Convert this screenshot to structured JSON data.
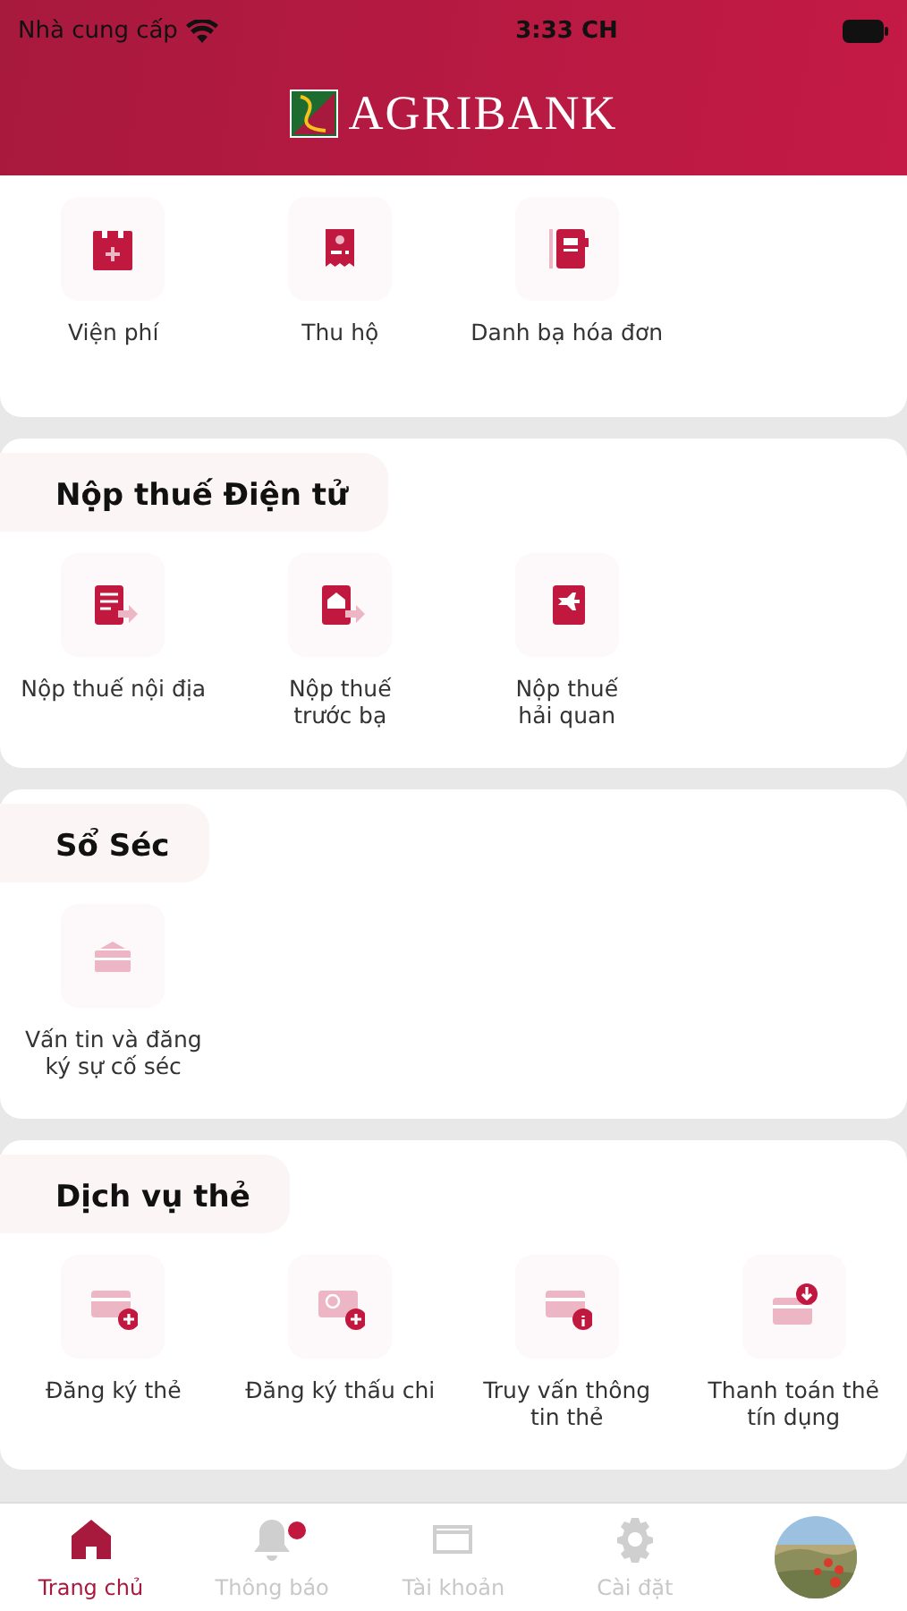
{
  "status_bar": {
    "carrier": "Nhà cung cấp",
    "time": "3:33 CH"
  },
  "header": {
    "logo_text": "AGRIBANK"
  },
  "sections": [
    {
      "items": [
        {
          "label": "Viện phí"
        },
        {
          "label": "Thu hộ"
        },
        {
          "label": "Danh bạ hóa đơn"
        }
      ]
    },
    {
      "title": "Nộp thuế Điện tử",
      "items": [
        {
          "label": "Nộp thuế nội địa"
        },
        {
          "label": "Nộp thuế\ntrước bạ"
        },
        {
          "label": "Nộp thuế\nhải quan"
        }
      ]
    },
    {
      "title": "Sổ Séc",
      "items": [
        {
          "label": "Vấn tin và đăng\nký sự cố séc"
        }
      ]
    },
    {
      "title": "Dịch vụ thẻ",
      "items": [
        {
          "label": "Đăng ký thẻ"
        },
        {
          "label": "Đăng ký thấu chi"
        },
        {
          "label": "Truy vấn thông\ntin thẻ"
        },
        {
          "label": "Thanh toán thẻ\ntín dụng"
        }
      ]
    }
  ],
  "tab_bar": [
    {
      "label": "Trang chủ",
      "selected": true,
      "badge": false
    },
    {
      "label": "Thông báo",
      "selected": false,
      "badge": true
    },
    {
      "label": "Tài khoản",
      "selected": false,
      "badge": false
    },
    {
      "label": "Cài đặt",
      "selected": false,
      "badge": false
    },
    {
      "kind": "picture",
      "selected": false,
      "badge": false
    }
  ]
}
